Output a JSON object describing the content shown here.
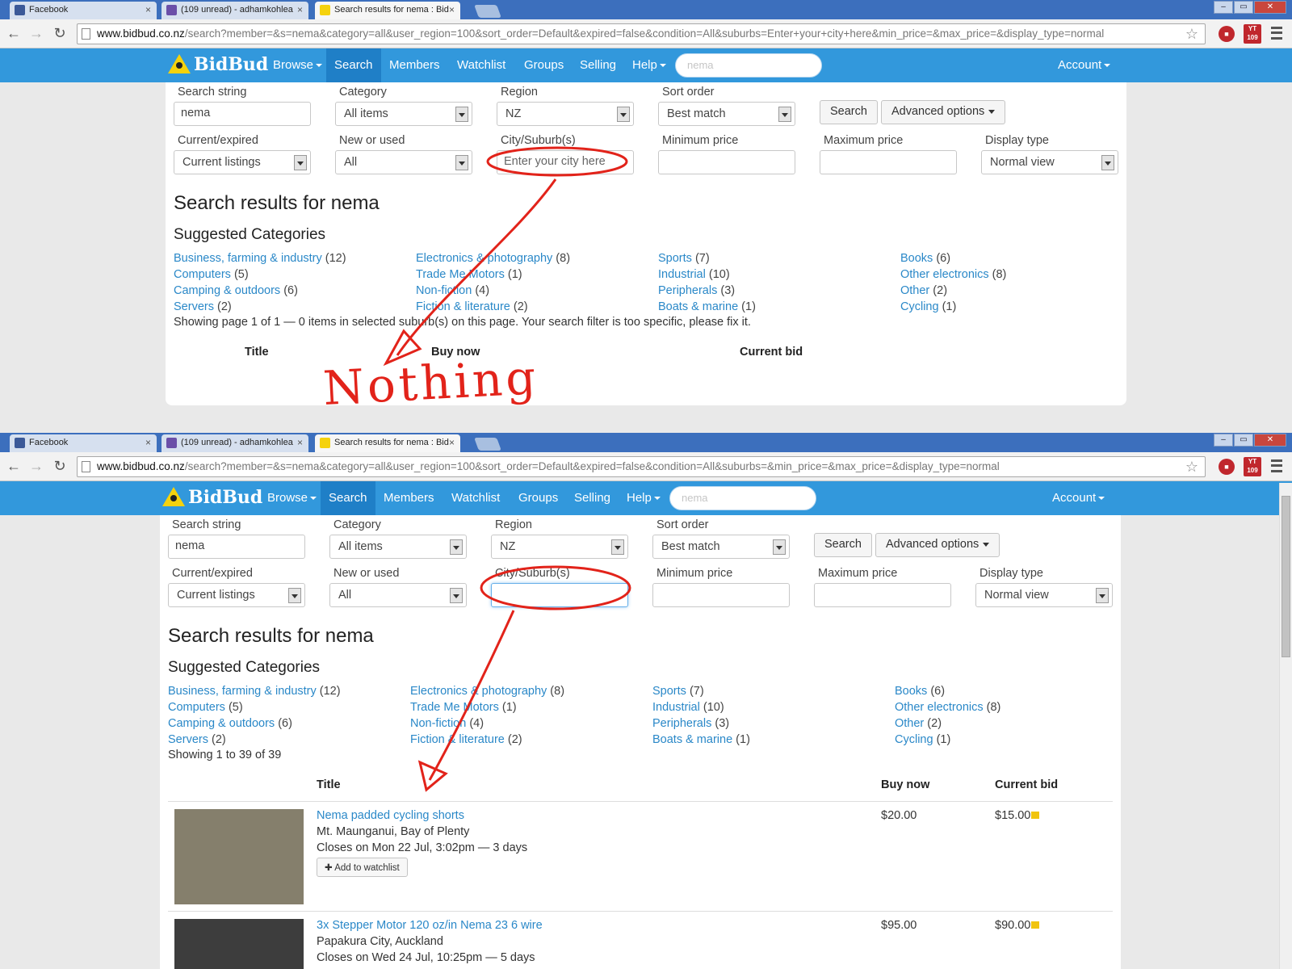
{
  "browser": {
    "tabs": [
      {
        "title": "Facebook",
        "icon": "facebook-icon"
      },
      {
        "title": "(109 unread) - adhamkohlea",
        "icon": "mail-icon"
      },
      {
        "title": "Search results for nema : Bid",
        "icon": "bidbud-icon"
      }
    ],
    "tab_close": "×",
    "url_host": "www.bidbud.co.nz",
    "url_path_top": "/search?member=&s=nema&category=all&user_region=100&sort_order=Default&expired=false&condition=All&suburbs=Enter+your+city+here&min_price=&max_price=&display_type=normal",
    "url_path_bottom": "/search?member=&s=nema&category=all&user_region=100&sort_order=Default&expired=false&condition=All&suburbs=&min_price=&max_price=&display_type=normal",
    "ext_badge": "109",
    "ext_label": "YT"
  },
  "nav": {
    "logo": "BidBud",
    "items": [
      "Browse",
      "Search",
      "Members",
      "Watchlist",
      "Groups",
      "Selling",
      "Help"
    ],
    "search_placeholder": "nema",
    "account": "Account"
  },
  "form": {
    "search_string_label": "Search string",
    "search_string_value": "nema",
    "category_label": "Category",
    "category_value": "All items",
    "region_label": "Region",
    "region_value": "NZ",
    "sort_label": "Sort order",
    "sort_value": "Best match",
    "search_button": "Search",
    "advanced_button": "Advanced options",
    "current_label": "Current/expired",
    "current_value": "Current listings",
    "newused_label": "New or used",
    "newused_value": "All",
    "city_label": "City/Suburb(s)",
    "city_value_top": "Enter your city here",
    "city_value_bottom": "",
    "minprice_label": "Minimum price",
    "maxprice_label": "Maximum price",
    "display_label": "Display type",
    "display_value": "Normal view"
  },
  "results": {
    "heading": "Search results for nema",
    "suggested": "Suggested Categories",
    "categories": [
      [
        {
          "name": "Business, farming & industry",
          "count": "(12)"
        },
        {
          "name": "Computers",
          "count": "(5)"
        },
        {
          "name": "Camping & outdoors",
          "count": "(6)"
        },
        {
          "name": "Servers",
          "count": "(2)"
        }
      ],
      [
        {
          "name": "Electronics & photography",
          "count": "(8)"
        },
        {
          "name": "Trade Me Motors",
          "count": "(1)"
        },
        {
          "name": "Non-fiction",
          "count": "(4)"
        },
        {
          "name": "Fiction & literature",
          "count": "(2)"
        }
      ],
      [
        {
          "name": "Sports",
          "count": "(7)"
        },
        {
          "name": "Industrial",
          "count": "(10)"
        },
        {
          "name": "Peripherals",
          "count": "(3)"
        },
        {
          "name": "Boats & marine",
          "count": "(1)"
        }
      ],
      [
        {
          "name": "Books",
          "count": "(6)"
        },
        {
          "name": "Other electronics",
          "count": "(8)"
        },
        {
          "name": "Other",
          "count": "(2)"
        },
        {
          "name": "Cycling",
          "count": "(1)"
        }
      ]
    ],
    "status_top": "Showing page 1 of 1 — 0 items in selected suburb(s) on this page. Your search filter is too specific, please fix it.",
    "status_bottom": "Showing 1 to 39 of 39",
    "col_title": "Title",
    "col_buynow": "Buy now",
    "col_currentbid": "Current bid",
    "listings": [
      {
        "title": "Nema padded cycling shorts",
        "location": "Mt. Maunganui, Bay of Plenty",
        "closes": "Closes on Mon 22 Jul, 3:02pm — 3 days",
        "buy_now": "$20.00",
        "current_bid": "$15.00",
        "watch": "Add to watchlist"
      },
      {
        "title": "3x Stepper Motor 120 oz/in Nema 23 6 wire",
        "location": "Papakura City, Auckland",
        "closes": "Closes on Wed 24 Jul, 10:25pm — 5 days",
        "buy_now": "$95.00",
        "current_bid": "$90.00"
      }
    ]
  },
  "annotation": {
    "nothing_text": "Nothing",
    "color": "#e2231a"
  }
}
